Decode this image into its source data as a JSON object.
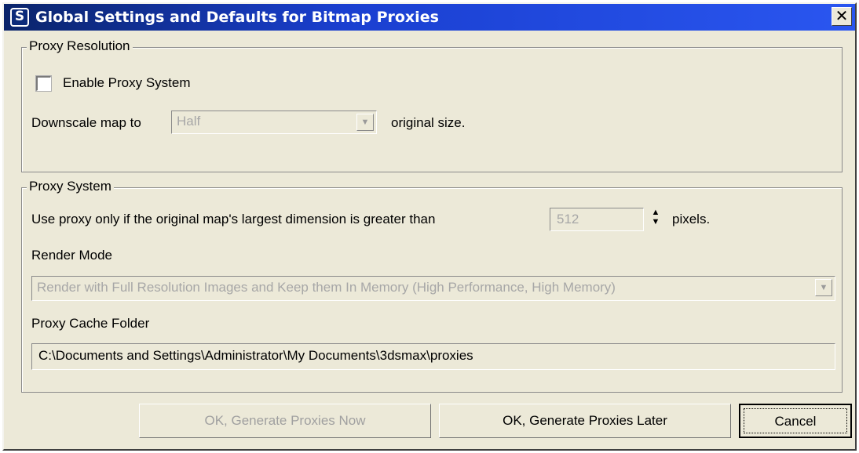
{
  "window": {
    "title": "Global Settings and Defaults for Bitmap Proxies",
    "app_icon_glyph": "S",
    "close_glyph": "✕"
  },
  "proxy_resolution": {
    "legend": "Proxy Resolution",
    "enable_label": "Enable Proxy System",
    "enable_checked": false,
    "downscale_prefix": "Downscale map to",
    "downscale_value": "Half",
    "downscale_suffix": "original size."
  },
  "proxy_system": {
    "legend": "Proxy System",
    "threshold_prefix": "Use proxy only if the original map's largest dimension is greater than",
    "threshold_value": "512",
    "threshold_suffix": "pixels.",
    "render_mode_label": "Render Mode",
    "render_mode_value": "Render with Full Resolution Images and Keep them In Memory (High Performance, High Memory)",
    "cache_folder_label": "Proxy Cache Folder",
    "cache_folder_value": "C:\\Documents and Settings\\Administrator\\My Documents\\3dsmax\\proxies"
  },
  "buttons": {
    "generate_now": "OK, Generate Proxies Now",
    "generate_later": "OK, Generate Proxies Later",
    "cancel": "Cancel"
  },
  "icons": {
    "combo_arrow": "▼",
    "spinner_up": "▲",
    "spinner_down": "▼"
  },
  "colors": {
    "titlebar": "#1a3fd0",
    "dialog_bg": "#ece9d8",
    "disabled_text": "#a7a7a7"
  }
}
